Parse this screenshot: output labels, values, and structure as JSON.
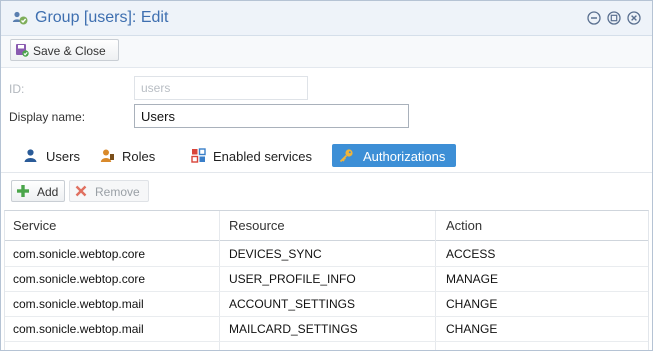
{
  "window": {
    "title": "Group [users]: Edit",
    "tools": [
      "minimize-icon",
      "maximize-icon",
      "close-icon"
    ]
  },
  "toolbar": {
    "save_close_label": "Save & Close"
  },
  "form": {
    "id_label": "ID:",
    "id_value": "users",
    "display_name_label": "Display name:",
    "display_name_value": "Users"
  },
  "tabs": [
    {
      "label": "Users",
      "icon": "user-icon",
      "active": false
    },
    {
      "label": "Roles",
      "icon": "roles-icon",
      "active": false
    },
    {
      "label": "Enabled services",
      "icon": "services-icon",
      "active": false
    },
    {
      "label": "Authorizations",
      "icon": "key-icon",
      "active": true
    }
  ],
  "grid_toolbar": {
    "add_label": "Add",
    "remove_label": "Remove"
  },
  "table": {
    "columns": [
      "Service",
      "Resource",
      "Action"
    ],
    "rows": [
      [
        "com.sonicle.webtop.core",
        "DEVICES_SYNC",
        "ACCESS"
      ],
      [
        "com.sonicle.webtop.core",
        "USER_PROFILE_INFO",
        "MANAGE"
      ],
      [
        "com.sonicle.webtop.mail",
        "ACCOUNT_SETTINGS",
        "CHANGE"
      ],
      [
        "com.sonicle.webtop.mail",
        "MAILCARD_SETTINGS",
        "CHANGE"
      ]
    ]
  },
  "colors": {
    "accent": "#3d8fd6",
    "title": "#3e6fb0",
    "add_icon": "#4aa54a",
    "remove_icon": "#e07060"
  }
}
